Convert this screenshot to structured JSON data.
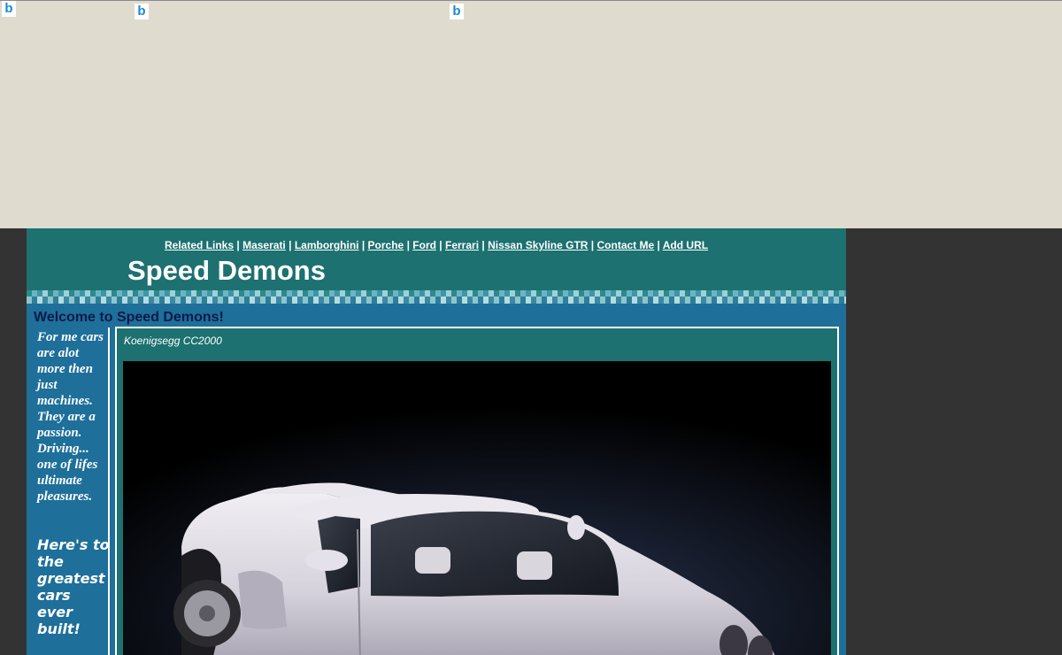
{
  "browser_icons": [
    "bing-icon",
    "bing-icon",
    "bing-icon"
  ],
  "nav": {
    "links": [
      "Related Links",
      "Maserati",
      "Lamborghini",
      "Porche",
      "Ford",
      "Ferrari",
      "Nissan Skyline GTR",
      "Contact Me",
      "Add URL"
    ],
    "separator": "|"
  },
  "header": {
    "title": "Speed Demons"
  },
  "welcome": "Welcome to Speed Demons!",
  "sidebar": {
    "text1": "For me cars are alot more then just machines. They are a passion. Driving... one of lifes ultimate pleasures.",
    "text2": "Here's to the greatest cars ever built!"
  },
  "feature": {
    "caption": "Koenigsegg CC2000"
  },
  "colors": {
    "top_band": "#dfdbcf",
    "page_bg": "#333333",
    "header_bg": "#1d7170",
    "site_bg": "#1e6f9a",
    "welcome_text": "#0d1a4a"
  }
}
